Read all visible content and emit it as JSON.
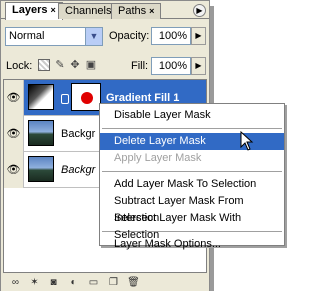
{
  "tabs": [
    {
      "label": "Layers",
      "active": true
    },
    {
      "label": "Channels",
      "active": false
    },
    {
      "label": "Paths",
      "active": false
    }
  ],
  "blend_mode": "Normal",
  "opacity": {
    "label": "Opacity:",
    "value": "100%"
  },
  "lock": {
    "label": "Lock:"
  },
  "fill": {
    "label": "Fill:",
    "value": "100%"
  },
  "layers": [
    {
      "name": "Gradient Fill 1",
      "selected": true
    },
    {
      "name": "Backgr",
      "selected": false
    },
    {
      "name": "Backgr",
      "selected": false
    }
  ],
  "context_menu": {
    "items": [
      {
        "label": "Disable Layer Mask",
        "state": "normal"
      },
      {
        "label": "Delete Layer Mask",
        "state": "hover"
      },
      {
        "label": "Apply Layer Mask",
        "state": "disabled"
      },
      {
        "label": "Add Layer Mask To Selection",
        "state": "normal"
      },
      {
        "label": "Subtract Layer Mask From Selection",
        "state": "normal"
      },
      {
        "label": "Intersect Layer Mask With Selection",
        "state": "normal"
      },
      {
        "label": "Layer Mask Options...",
        "state": "normal"
      }
    ]
  },
  "colors": {
    "selection": "#316ac5",
    "panel_bg": "#ece9d8",
    "mask_dot": "#e00000"
  }
}
